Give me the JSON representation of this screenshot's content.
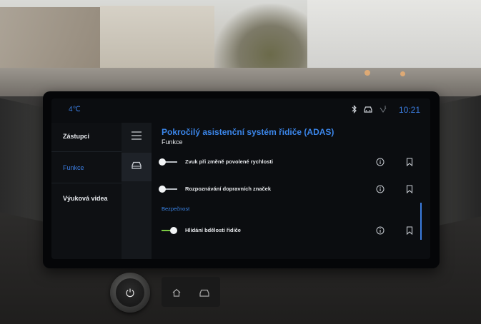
{
  "statusbar": {
    "ext_temp": "4℃",
    "time": "10:21",
    "icons": [
      "bluetooth-icon",
      "car-icon",
      "signal-icon"
    ],
    "accent_color": "#3b7de0"
  },
  "left_menu": {
    "items": [
      {
        "label": "Zástupci",
        "active": false
      },
      {
        "label": "Funkce",
        "active": true
      },
      {
        "label": "Výuková videa",
        "active": false
      }
    ]
  },
  "rail": {
    "items": [
      {
        "icon": "hamburger-icon",
        "active": false
      },
      {
        "icon": "car-icon",
        "active": true
      }
    ]
  },
  "content": {
    "title": "Pokročilý asistenční systém řidiče (ADAS)",
    "subtitle": "Funkce",
    "section_label": "Bezpečnost",
    "rows": [
      {
        "label": "Zvuk při změně povolené rychlosti",
        "enabled": false
      },
      {
        "label": "Rozpoznávání dopravních značek",
        "enabled": false
      },
      {
        "label": "Hlídání bdělosti řidiče",
        "enabled": true
      }
    ]
  },
  "hardware": {
    "buttons": [
      "power-icon",
      "home-icon",
      "car-icon"
    ]
  },
  "colors": {
    "accent": "#3b86ea",
    "toggle_on": "#7ac943",
    "screen_bg": "#0b0d10"
  }
}
